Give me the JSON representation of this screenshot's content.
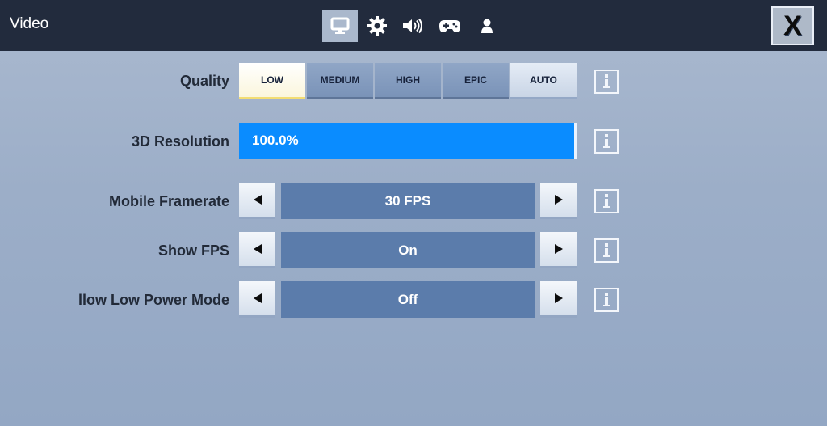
{
  "header": {
    "title": "Video",
    "close_label": "X",
    "tabs": [
      {
        "icon": "monitor-icon",
        "active": true
      },
      {
        "icon": "gear-icon",
        "active": false
      },
      {
        "icon": "speaker-icon",
        "active": false
      },
      {
        "icon": "gamepad-icon",
        "active": false
      },
      {
        "icon": "person-icon",
        "active": false
      }
    ]
  },
  "settings": {
    "quality": {
      "label": "Quality",
      "options": [
        "LOW",
        "MEDIUM",
        "HIGH",
        "EPIC",
        "AUTO"
      ],
      "selected": "LOW"
    },
    "resolution": {
      "label": "3D Resolution",
      "value_text": "100.0%",
      "fraction": 1.0
    },
    "framerate": {
      "label": "Mobile Framerate",
      "value": "30 FPS"
    },
    "show_fps": {
      "label": "Show FPS",
      "value": "On"
    },
    "low_power": {
      "label": "llow Low Power Mode",
      "value": "Off"
    }
  },
  "colors": {
    "topbar": "#222b3d",
    "accent_blue": "#0a8cff",
    "value_box": "#5b7cab",
    "selected_highlight": "#f3dd72"
  }
}
